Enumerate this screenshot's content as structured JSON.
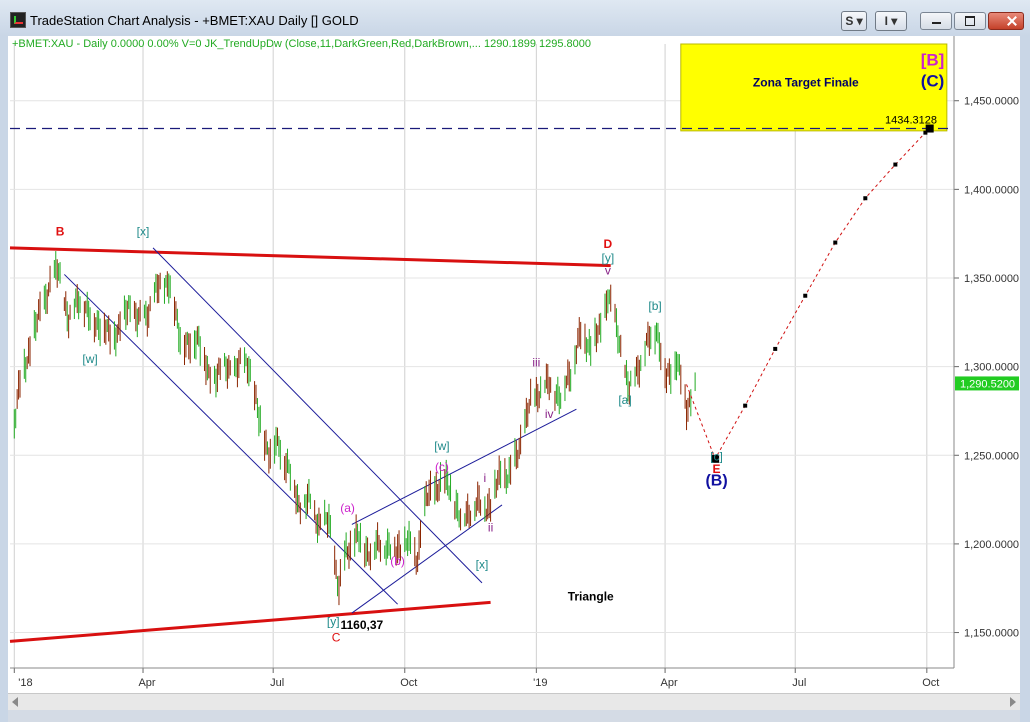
{
  "window": {
    "title": "TradeStation Chart Analysis - +BMET:XAU Daily [] GOLD",
    "buttons": [
      {
        "label": "S ▾"
      },
      {
        "label": "I ▾"
      }
    ]
  },
  "colors": {
    "price_up": "#22aa22",
    "price_down": "#8b2500",
    "wave_red": "#e01010",
    "teal": "#1f8a8a",
    "magenta": "#cc22cc",
    "purple": "#882288",
    "blue": "#1010a0",
    "target_zone": "#ffff00",
    "last_price_bg": "#22cc22"
  },
  "chart_data": {
    "type": "line",
    "title": "+BMET:XAU - Daily",
    "header_text": "+BMET:XAU - Daily  0.0000  0.00%  V=0  JK_TrendUpDw (Close,11,DarkGreen,Red,DarkBrown,...  1290.1899  1295.8000",
    "series": [
      {
        "values": [
          [
            "2018-01-01",
            1270
          ],
          [
            "2018-01-05",
            1290
          ],
          [
            "2018-01-15",
            1320
          ],
          [
            "2018-01-25",
            1345
          ],
          [
            "2018-02-01",
            1355
          ],
          [
            "2018-02-08",
            1325
          ],
          [
            "2018-02-15",
            1340
          ],
          [
            "2018-02-22",
            1328
          ],
          [
            "2018-03-01",
            1325
          ],
          [
            "2018-03-08",
            1318
          ],
          [
            "2018-03-15",
            1320
          ],
          [
            "2018-03-22",
            1335
          ],
          [
            "2018-03-29",
            1325
          ],
          [
            "2018-04-05",
            1332
          ],
          [
            "2018-04-12",
            1345
          ],
          [
            "2018-04-19",
            1348
          ],
          [
            "2018-04-26",
            1320
          ],
          [
            "2018-05-03",
            1310
          ],
          [
            "2018-05-10",
            1318
          ],
          [
            "2018-05-17",
            1292
          ],
          [
            "2018-05-24",
            1298
          ],
          [
            "2018-05-31",
            1298
          ],
          [
            "2018-06-07",
            1300
          ],
          [
            "2018-06-14",
            1302
          ],
          [
            "2018-06-21",
            1270
          ],
          [
            "2018-06-28",
            1252
          ],
          [
            "2018-07-05",
            1256
          ],
          [
            "2018-07-12",
            1242
          ],
          [
            "2018-07-19",
            1222
          ],
          [
            "2018-07-26",
            1224
          ],
          [
            "2018-08-02",
            1212
          ],
          [
            "2018-08-09",
            1212
          ],
          [
            "2018-08-16",
            1175
          ],
          [
            "2018-08-21",
            1195
          ],
          [
            "2018-08-28",
            1205
          ],
          [
            "2018-09-04",
            1196
          ],
          [
            "2018-09-11",
            1198
          ],
          [
            "2018-09-18",
            1200
          ],
          [
            "2018-09-25",
            1195
          ],
          [
            "2018-10-02",
            1203
          ],
          [
            "2018-10-09",
            1190
          ],
          [
            "2018-10-16",
            1225
          ],
          [
            "2018-10-23",
            1232
          ],
          [
            "2018-10-26",
            1235
          ],
          [
            "2018-11-02",
            1232
          ],
          [
            "2018-11-09",
            1213
          ],
          [
            "2018-11-16",
            1220
          ],
          [
            "2018-11-23",
            1222
          ],
          [
            "2018-11-30",
            1222
          ],
          [
            "2018-12-07",
            1240
          ],
          [
            "2018-12-14",
            1238
          ],
          [
            "2018-12-21",
            1258
          ],
          [
            "2018-12-28",
            1280
          ],
          [
            "2019-01-04",
            1288
          ],
          [
            "2019-01-11",
            1290
          ],
          [
            "2019-01-18",
            1282
          ],
          [
            "2019-01-25",
            1298
          ],
          [
            "2019-02-01",
            1318
          ],
          [
            "2019-02-08",
            1312
          ],
          [
            "2019-02-15",
            1320
          ],
          [
            "2019-02-20",
            1342
          ],
          [
            "2019-02-27",
            1318
          ],
          [
            "2019-03-07",
            1286
          ],
          [
            "2019-03-14",
            1302
          ],
          [
            "2019-03-21",
            1315
          ],
          [
            "2019-03-26",
            1322
          ],
          [
            "2019-04-02",
            1292
          ],
          [
            "2019-04-09",
            1305
          ],
          [
            "2019-04-16",
            1276
          ],
          [
            "2019-04-23",
            1290
          ]
        ]
      },
      {
        "name": "projection",
        "style": "dotted",
        "values": [
          [
            "2019-04-16",
            1290
          ],
          [
            "2019-05-06",
            1248
          ],
          [
            "2019-05-27",
            1278
          ],
          [
            "2019-06-17",
            1310
          ],
          [
            "2019-07-08",
            1340
          ],
          [
            "2019-07-29",
            1370
          ],
          [
            "2019-08-19",
            1395
          ],
          [
            "2019-09-09",
            1414
          ],
          [
            "2019-09-30",
            1432
          ],
          [
            "2019-10-03",
            1434.3128
          ]
        ]
      }
    ],
    "x_ticks": [
      "'18",
      "Apr",
      "Jul",
      "Oct",
      "'19",
      "Apr",
      "Jul",
      "Oct"
    ],
    "y_ticks": [
      "1,150.0000",
      "1,200.0000",
      "1,250.0000",
      "1,300.0000",
      "1,350.0000",
      "1,400.0000",
      "1,450.0000"
    ],
    "ylim": [
      1130,
      1482
    ],
    "xlim": [
      "2017-12-29",
      "2019-10-20"
    ],
    "last_price": "1,290.5200",
    "target_line": {
      "value": 1434.3128,
      "label": "1434.3128"
    },
    "target_zone": {
      "x_from": "2019-04-12",
      "x_to": "2019-10-15",
      "y_from": 1433,
      "y_to": 1482,
      "label": "Zona Target Finale"
    },
    "lines": [
      {
        "name": "triangle-upper",
        "color": "red",
        "points": [
          [
            "2017-12-29",
            1367
          ],
          [
            "2019-02-22",
            1357
          ]
        ]
      },
      {
        "name": "triangle-lower",
        "color": "red",
        "points": [
          [
            "2017-12-29",
            1145
          ],
          [
            "2018-11-30",
            1167
          ]
        ]
      },
      {
        "name": "channel-down-upper",
        "color": "blue",
        "points": [
          [
            "2018-04-08",
            1367
          ],
          [
            "2018-11-24",
            1178
          ]
        ]
      },
      {
        "name": "channel-down-lower",
        "color": "blue",
        "points": [
          [
            "2018-02-05",
            1352
          ],
          [
            "2018-09-26",
            1166
          ]
        ]
      },
      {
        "name": "channel-up-upper",
        "color": "blue",
        "points": [
          [
            "2018-08-25",
            1211
          ],
          [
            "2019-01-29",
            1276
          ]
        ]
      },
      {
        "name": "channel-up-lower",
        "color": "blue",
        "points": [
          [
            "2018-08-25",
            1161
          ],
          [
            "2018-12-08",
            1222
          ]
        ]
      }
    ],
    "annotations": [
      {
        "text": "B",
        "x": "2018-02-02",
        "y": 1374,
        "color": "red",
        "bold": true
      },
      {
        "text": "[x]",
        "x": "2018-04-01",
        "y": 1374,
        "color": "teal"
      },
      {
        "text": "[w]",
        "x": "2018-02-23",
        "y": 1302,
        "color": "teal"
      },
      {
        "text": "C",
        "x": "2018-08-14",
        "y": 1145,
        "color": "red",
        "bold": false
      },
      {
        "text": "[y]",
        "x": "2018-08-12",
        "y": 1154,
        "color": "teal"
      },
      {
        "text": "1160,37",
        "x": "2018-09-01",
        "y": 1152,
        "color": "black",
        "bold": true
      },
      {
        "text": "(a)",
        "x": "2018-08-22",
        "y": 1218,
        "color": "magenta"
      },
      {
        "text": "(b)",
        "x": "2018-09-26",
        "y": 1188,
        "color": "magenta"
      },
      {
        "text": "(c)",
        "x": "2018-10-27",
        "y": 1241,
        "color": "magenta"
      },
      {
        "text": "[w]",
        "x": "2018-10-27",
        "y": 1253,
        "color": "teal"
      },
      {
        "text": "[x]",
        "x": "2018-11-24",
        "y": 1186,
        "color": "teal"
      },
      {
        "text": "i",
        "x": "2018-11-26",
        "y": 1235,
        "color": "purple"
      },
      {
        "text": "ii",
        "x": "2018-11-30",
        "y": 1207,
        "color": "purple"
      },
      {
        "text": "iii",
        "x": "2019-01-01",
        "y": 1300,
        "color": "purple"
      },
      {
        "text": "iv",
        "x": "2019-01-10",
        "y": 1271,
        "color": "purple"
      },
      {
        "text": "D",
        "x": "2019-02-20",
        "y": 1367,
        "color": "red",
        "bold": true
      },
      {
        "text": "[y]",
        "x": "2019-02-20",
        "y": 1359,
        "color": "teal"
      },
      {
        "text": "v",
        "x": "2019-02-20",
        "y": 1352,
        "color": "purple"
      },
      {
        "text": "[a]",
        "x": "2019-03-04",
        "y": 1279,
        "color": "teal"
      },
      {
        "text": "[b]",
        "x": "2019-03-25",
        "y": 1332,
        "color": "teal"
      },
      {
        "text": "[c]",
        "x": "2019-05-07",
        "y": 1247,
        "color": "teal"
      },
      {
        "text": "E",
        "x": "2019-05-07",
        "y": 1240,
        "color": "red",
        "bold": true
      },
      {
        "text": "(B)",
        "x": "2019-05-07",
        "y": 1233,
        "color": "blue",
        "bold": true,
        "size": 16
      },
      {
        "text": "Triangle",
        "x": "2019-02-08",
        "y": 1168,
        "color": "black",
        "bold": true
      },
      {
        "text": "[B]",
        "x": "2019-10-05",
        "y": 1470,
        "color": "magenta",
        "bold": true,
        "size": 17
      },
      {
        "text": "(C)",
        "x": "2019-10-05",
        "y": 1458,
        "color": "blue",
        "bold": true,
        "size": 17
      }
    ]
  }
}
